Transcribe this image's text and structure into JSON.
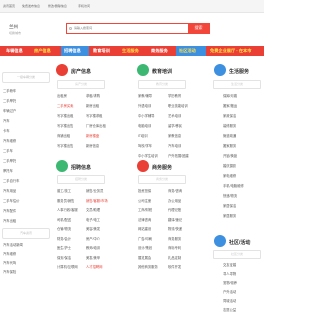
{
  "topbar": {
    "links": [
      "资讯首页",
      "免费发布信息",
      "修改/删除信息",
      "手机访问"
    ]
  },
  "header": {
    "city": "兰州",
    "city_switch": "切换城市"
  },
  "search": {
    "placeholder": "请输入搜索词",
    "button": "搜索"
  },
  "nav": {
    "items": [
      {
        "label": "车辆信息"
      },
      {
        "label": "房产信息"
      },
      {
        "label": "招聘信息"
      },
      {
        "label": "教育培训"
      },
      {
        "label": "生活服务"
      },
      {
        "label": "商务服务"
      },
      {
        "label": "社区活动"
      },
      {
        "label": "免费企业展厅 - 在本市"
      }
    ]
  },
  "left": {
    "head": "一级车辆分类",
    "items": [
      "二手轿车",
      "二手摩托",
      "车辆过户",
      "汽车",
      "卡车",
      "汽车维修",
      "二手车",
      "二手摩托",
      "摩托车",
      "二手自行车",
      "汽车用品",
      "二手车估价",
      "汽车配件",
      "汽车出租"
    ],
    "head2": "汽车资讯",
    "items2": [
      "汽车活动新闻",
      "汽车维修",
      "汽车代驾",
      "汽车保险",
      "汽车/商户"
    ]
  },
  "house": {
    "title": "房产信息",
    "head": "房产分类",
    "col_a": [
      "出租房",
      "二手房买卖",
      "写字楼出租",
      "写字楼出售",
      "商铺出租",
      "写字楼出售"
    ],
    "col_b": [
      "求租/求购",
      "新房出租",
      "写字楼求租",
      "厂房仓库出租",
      "新房楼盘",
      "新房信息"
    ],
    "col_a_color": [
      "",
      "red",
      "",
      "",
      "",
      ""
    ],
    "col_b_color": [
      "",
      "",
      "",
      "",
      "red",
      ""
    ]
  },
  "edu": {
    "title": "教育培训",
    "head": "教育分类",
    "col_a": [
      "家教/辅导",
      "外语培训",
      "中小学辅导",
      "电脑培训",
      "IT培训",
      "驾校/学车",
      "中小学生培训"
    ],
    "col_b": [
      "学历教育",
      "职业技能培训",
      "艺术培训",
      "留学/移民",
      "家教信息",
      "汽车培训",
      "户外拓展/团建"
    ]
  },
  "life": {
    "title": "生活服务",
    "head": "生活分类",
    "items": [
      "保姆/月嫂",
      "搬家/搬运",
      "家政保洁",
      "装修服务",
      "管道疏通",
      "搬家服务",
      "开锁/换锁",
      "婚庆摄影",
      "家电维修",
      "手机/电脑维修",
      "快递/物流",
      "家居保洁",
      "家居服务"
    ]
  },
  "jobs": {
    "title": "招聘信息",
    "head": "招聘分类",
    "col_a": [
      "普工/技工",
      "服务员/销售",
      "人事行政/客服",
      "司机/配送",
      "仓管/物流",
      "财务/会计",
      "医生/护士",
      "保安/保洁",
      "计算机/互联网"
    ],
    "col_b": [
      "销售/业务员",
      "销售/客服/市场",
      "文员/助理",
      "电子/电工",
      "美容/美发",
      "房产/中介",
      "教师/培训",
      "美发/美甲",
      "人才招聘网"
    ],
    "col_a_color": [
      "",
      "",
      "",
      "",
      "",
      "",
      "",
      "",
      ""
    ],
    "col_b_color": [
      "",
      "red",
      "",
      "",
      "",
      "",
      "",
      "",
      "red"
    ]
  },
  "biz": {
    "title": "商务服务",
    "head": "商务分类",
    "col_a": [
      "投资担保",
      "公司注册",
      "工商/财税",
      "法律咨询",
      "网站建设",
      "广告/印刷",
      "设计/策划",
      "展览展会",
      "其他商务服务"
    ],
    "col_b": [
      "商务/咨询",
      "办公用品",
      "代理记账",
      "翻译/速记",
      "物流/快递",
      "商务服务",
      "商标专利",
      "礼品定制",
      "软件开发"
    ]
  },
  "community": {
    "title": "社区/活动",
    "head": "社区分类",
    "items": [
      "交友征婚",
      "寻人寻物",
      "宠物/领养",
      "户外活动",
      "同城活动",
      "志愿公益"
    ]
  }
}
